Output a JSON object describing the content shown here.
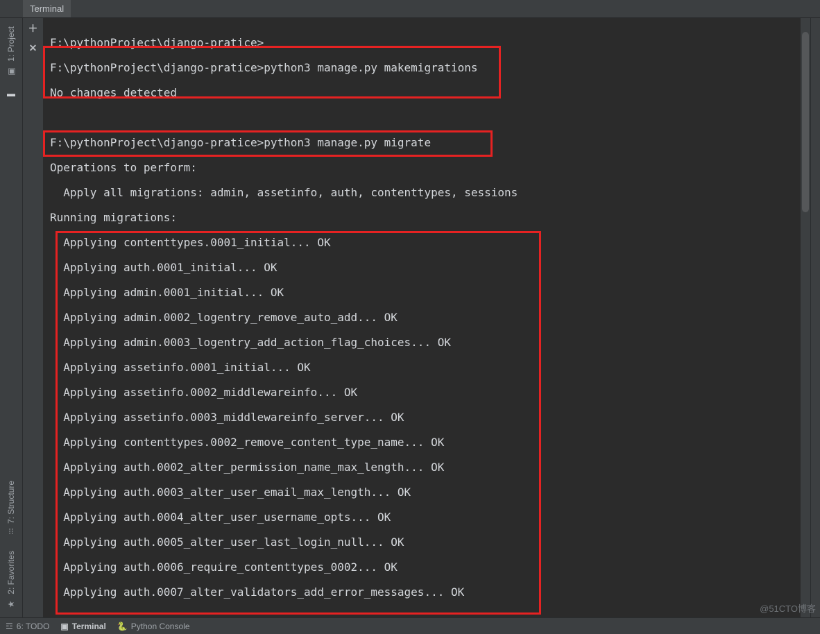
{
  "panel": {
    "title": "Terminal"
  },
  "left_rail": {
    "project": "1: Project",
    "structure": "7: Structure",
    "favorites": "2: Favorites"
  },
  "tool_col": {
    "plus": "＋",
    "close": "✕"
  },
  "terminal": {
    "lines": [
      "",
      "F:\\pythonProject\\django-pratice>",
      "",
      "F:\\pythonProject\\django-pratice>python3 manage.py makemigrations",
      "",
      "No changes detected",
      "",
      "",
      "",
      "F:\\pythonProject\\django-pratice>python3 manage.py migrate",
      "",
      "Operations to perform:",
      "",
      "  Apply all migrations: admin, assetinfo, auth, contenttypes, sessions",
      "",
      "Running migrations:",
      "",
      "  Applying contenttypes.0001_initial... OK",
      "",
      "  Applying auth.0001_initial... OK",
      "",
      "  Applying admin.0001_initial... OK",
      "",
      "  Applying admin.0002_logentry_remove_auto_add... OK",
      "",
      "  Applying admin.0003_logentry_add_action_flag_choices... OK",
      "",
      "  Applying assetinfo.0001_initial... OK",
      "",
      "  Applying assetinfo.0002_middlewareinfo... OK",
      "",
      "  Applying assetinfo.0003_middlewareinfo_server... OK",
      "",
      "  Applying contenttypes.0002_remove_content_type_name... OK",
      "",
      "  Applying auth.0002_alter_permission_name_max_length... OK",
      "",
      "  Applying auth.0003_alter_user_email_max_length... OK",
      "",
      "  Applying auth.0004_alter_user_username_opts... OK",
      "",
      "  Applying auth.0005_alter_user_last_login_null... OK",
      "",
      "  Applying auth.0006_require_contenttypes_0002... OK",
      "",
      "  Applying auth.0007_alter_validators_add_error_messages... OK",
      ""
    ]
  },
  "bottom": {
    "todo": "6: TODO",
    "terminal": "Terminal",
    "pyconsole": "Python Console"
  },
  "watermark": "@51CTO博客"
}
